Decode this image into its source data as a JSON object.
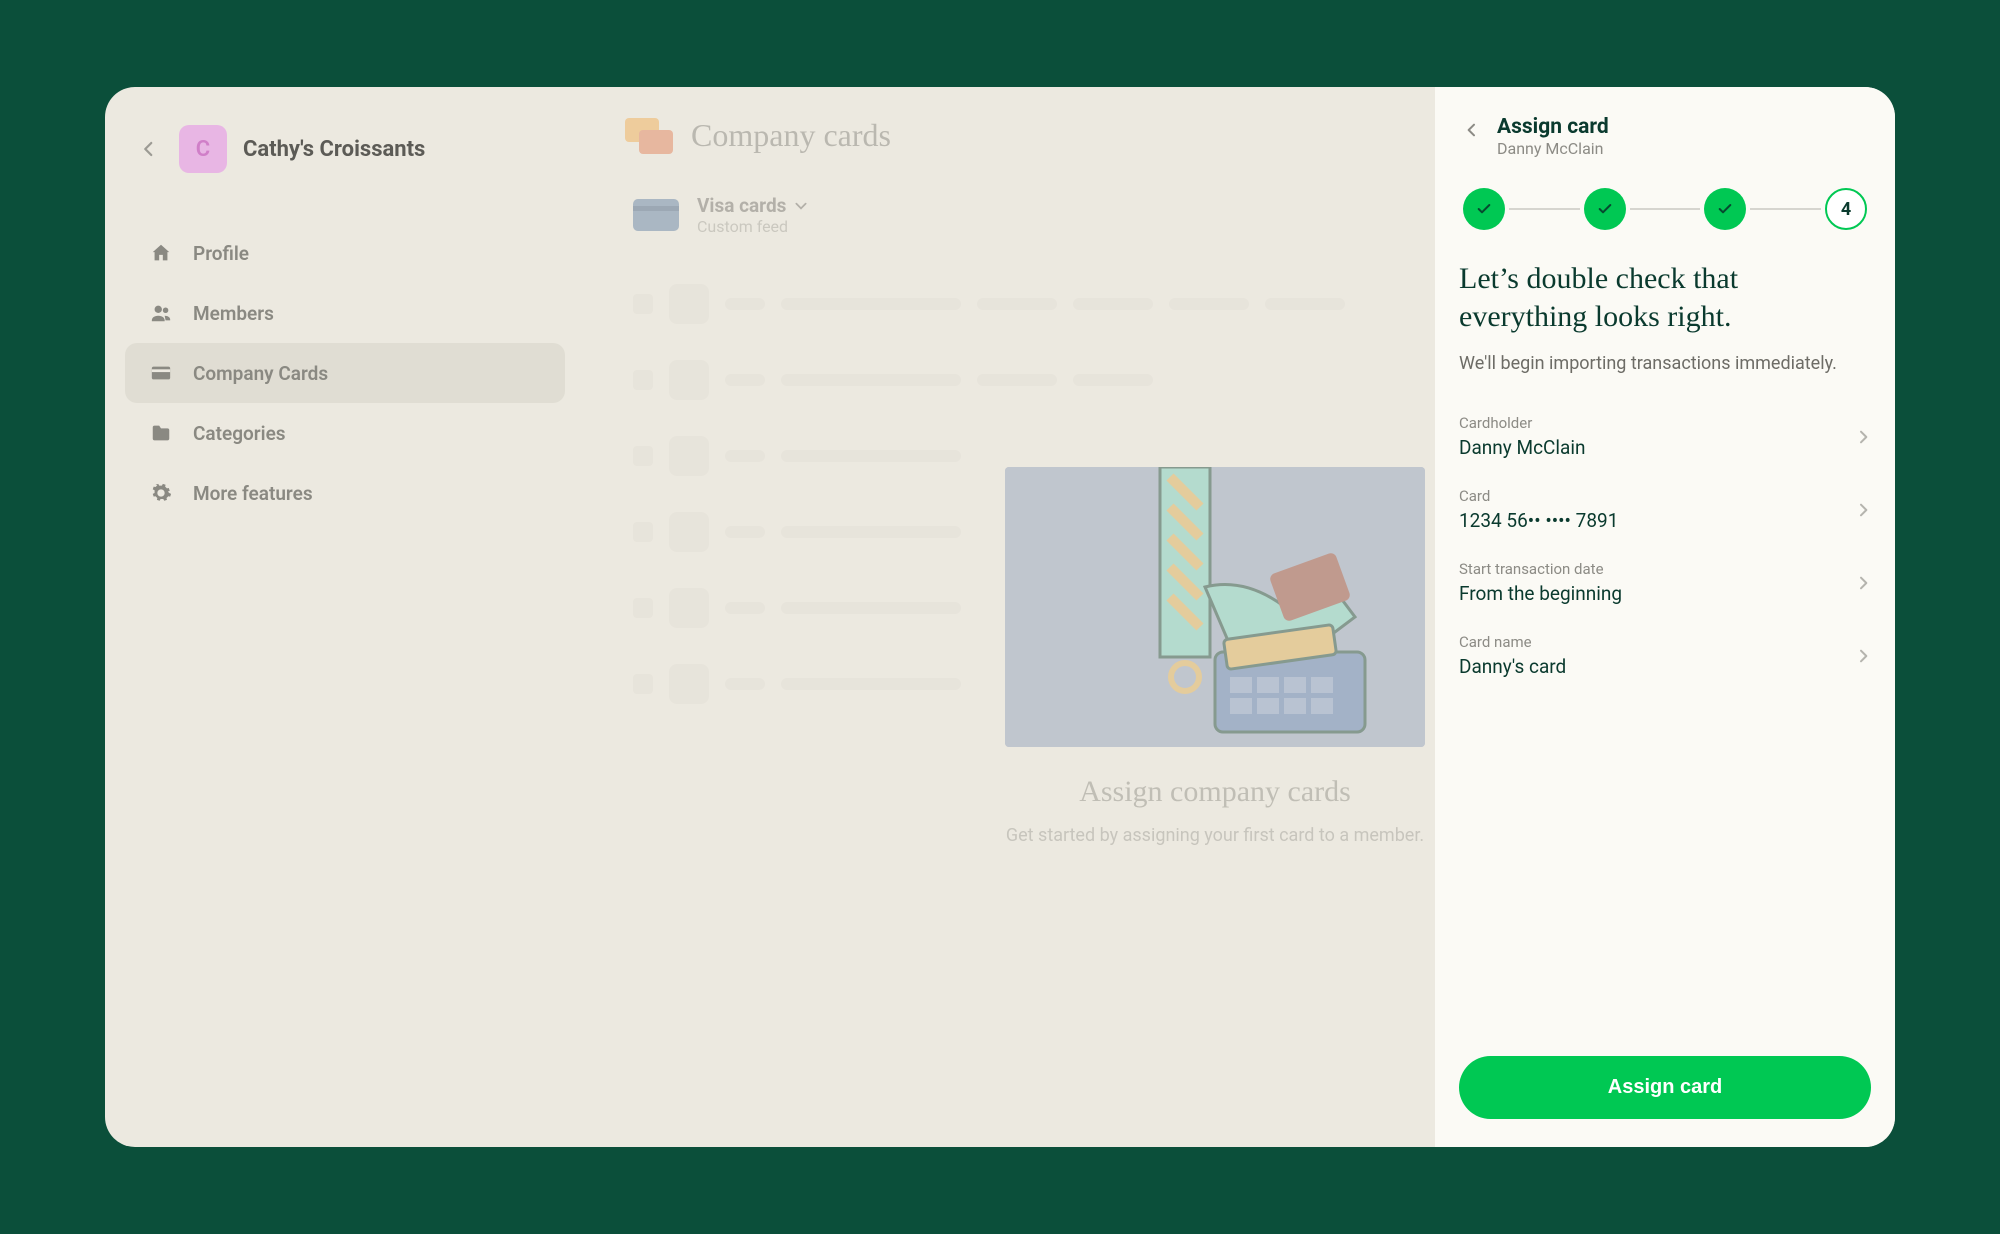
{
  "workspace": {
    "initial": "C",
    "name": "Cathy's Croissants"
  },
  "sidebar": {
    "items": [
      {
        "label": "Profile",
        "icon": "home"
      },
      {
        "label": "Members",
        "icon": "members"
      },
      {
        "label": "Company Cards",
        "icon": "card"
      },
      {
        "label": "Categories",
        "icon": "folder"
      },
      {
        "label": "More features",
        "icon": "gear"
      }
    ]
  },
  "main": {
    "title": "Company cards",
    "feed": {
      "title": "Visa cards",
      "subtitle": "Custom feed"
    },
    "promo": {
      "title": "Assign company cards",
      "subtitle": "Get started by assigning your first card to a member."
    }
  },
  "panel": {
    "title": "Assign card",
    "subtitle": "Danny McClain",
    "stepper": {
      "current": "4"
    },
    "heading": "Let’s double check that everything looks right.",
    "description": "We'll begin importing transactions immediately.",
    "review": [
      {
        "label": "Cardholder",
        "value": "Danny McClain"
      },
      {
        "label": "Card",
        "value": "1234 56•• •••• 7891"
      },
      {
        "label": "Start transaction date",
        "value": "From the beginning"
      },
      {
        "label": "Card name",
        "value": "Danny's card"
      }
    ],
    "submit_label": "Assign card"
  }
}
